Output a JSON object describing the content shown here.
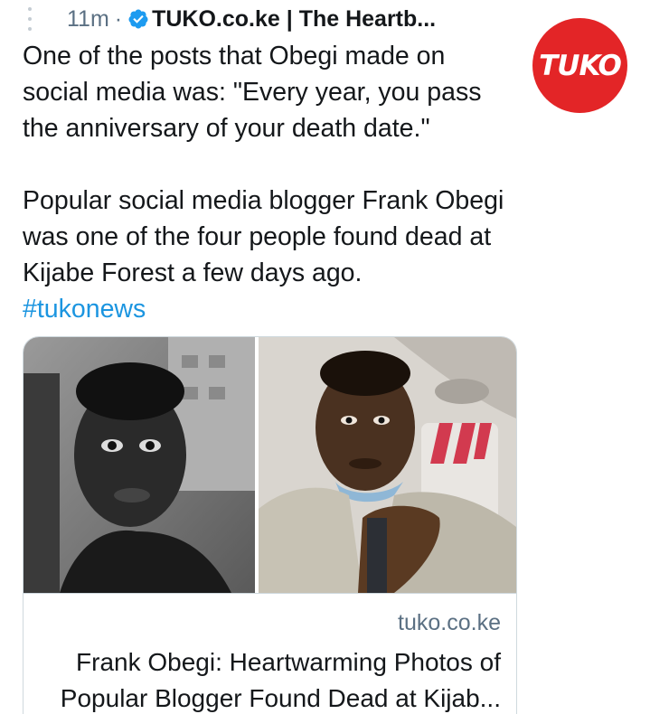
{
  "tweet": {
    "time": "11m",
    "separator": "·",
    "source": "TUKO.co.ke | The Heartb...",
    "paragraph1": "One of the posts that Obegi made on social media was: \"Every year, you pass the anniversary of your death date.\"",
    "paragraph2": "Popular social media blogger Frank Obegi was one of the four people found dead at Kijabe Forest a few days ago.",
    "hashtag": "#tukonews"
  },
  "avatar": {
    "text": "TUKO",
    "color": "#e32527"
  },
  "card": {
    "domain": "tuko.co.ke",
    "title_line1": "Frank Obegi: Heartwarming Photos of",
    "title_line2": "Popular Blogger Found Dead at Kijab..."
  },
  "colors": {
    "link": "#1b95e0",
    "muted": "#5b7083",
    "verified": "#1d9bf0",
    "brand": "#e32527"
  },
  "icons": {
    "verified": "verified-badge-icon",
    "thread": "thread-line-icon"
  }
}
